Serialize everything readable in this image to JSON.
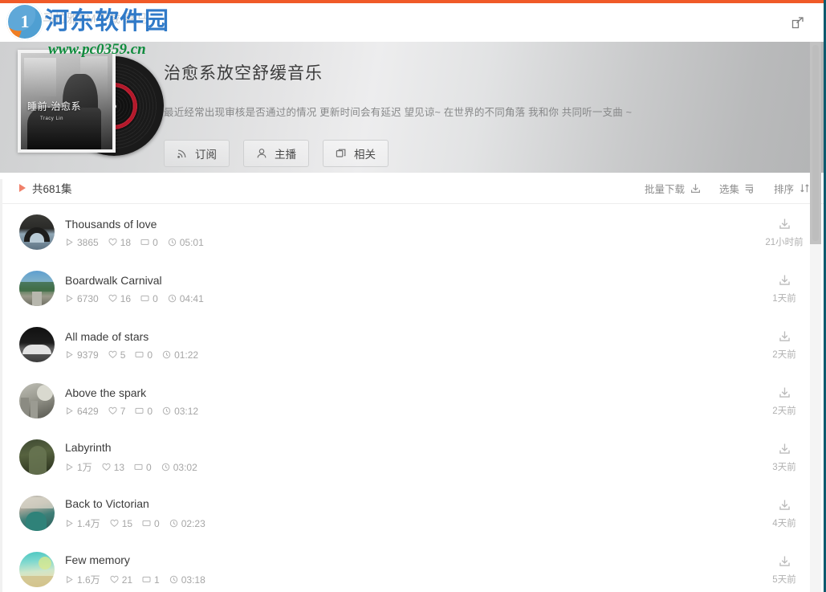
{
  "window": {
    "accent_color": "#f05a28",
    "border_color": "#0d5a6e"
  },
  "watermark": {
    "site_name": "河东软件园",
    "url": "www.pc0359.cn",
    "ghost_text": "喜马拉雅FM下载-喜马",
    "ghost_red": "FM"
  },
  "utilbar": {
    "share_icon": "share-icon"
  },
  "hero": {
    "title": "治愈系放空舒缓音乐",
    "description": "最近经常出现审核是否通过的情况 更新时间会有延迟 望见谅~ 在世界的不同角落 我和你 共同听一支曲 ~",
    "album": {
      "cover_title": "睡前·治愈系",
      "cover_subtitle": "Tracy Lin"
    },
    "actions": [
      {
        "label": "订阅",
        "icon": "rss-icon"
      },
      {
        "label": "主播",
        "icon": "person-icon"
      },
      {
        "label": "相关",
        "icon": "layers-icon"
      }
    ]
  },
  "listbar": {
    "count_label": "共681集",
    "play_icon": "play-triangle-icon",
    "tools": [
      {
        "label": "批量下载",
        "icon": "download-icon"
      },
      {
        "label": "选集",
        "icon": "playlist-icon"
      },
      {
        "label": "排序",
        "icon": "sort-icon"
      }
    ]
  },
  "episodes": [
    {
      "title": "Thousands of love",
      "plays": "3865",
      "likes": "18",
      "comments": "0",
      "duration": "05:01",
      "date": "21小时前",
      "download_icon": "download-icon",
      "thumb": "architecture-arch"
    },
    {
      "title": "Boardwalk Carnival",
      "plays": "6730",
      "likes": "16",
      "comments": "0",
      "duration": "04:41",
      "date": "1天前",
      "download_icon": "download-icon",
      "thumb": "mountain-road"
    },
    {
      "title": "All made of stars",
      "plays": "9379",
      "likes": "5",
      "comments": "0",
      "duration": "01:22",
      "date": "2天前",
      "download_icon": "download-icon",
      "thumb": "night-barn"
    },
    {
      "title": "Above the spark",
      "plays": "6429",
      "likes": "7",
      "comments": "0",
      "duration": "03:12",
      "date": "2天前",
      "download_icon": "download-icon",
      "thumb": "stone-building"
    },
    {
      "title": "Labyrinth",
      "plays": "1万",
      "likes": "13",
      "comments": "0",
      "duration": "03:02",
      "date": "3天前",
      "download_icon": "download-icon",
      "thumb": "green-forest"
    },
    {
      "title": "Back to Victorian",
      "plays": "1.4万",
      "likes": "15",
      "comments": "0",
      "duration": "02:23",
      "date": "4天前",
      "download_icon": "download-icon",
      "thumb": "teal-portrait"
    },
    {
      "title": "Few memory",
      "plays": "1.6万",
      "likes": "21",
      "comments": "1",
      "duration": "03:18",
      "date": "5天前",
      "download_icon": "download-icon",
      "thumb": "beach-sunset"
    }
  ]
}
